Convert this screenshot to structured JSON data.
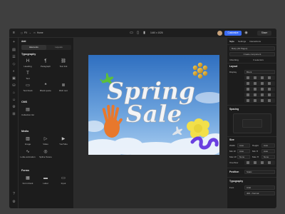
{
  "toolbar": {
    "page_size": "PX",
    "page_name": "Home",
    "canvas_size": "1440 x 1026",
    "publish_label": "Customize",
    "share_label": "Share"
  },
  "add_panel": {
    "title": "Add",
    "tabs": [
      "Elements",
      "Layouts"
    ],
    "sections": {
      "typography": {
        "title": "Typography",
        "items": [
          "Heading",
          "Paragraph",
          "Text link",
          "Text",
          "Text block",
          "Block quote",
          "Rich text"
        ]
      },
      "cms": {
        "title": "CMS",
        "items": [
          "Collection list"
        ]
      },
      "media": {
        "title": "Media",
        "items": [
          "Image",
          "Video",
          "YouTube",
          "Lottie animation",
          "Spline Scene"
        ]
      },
      "forms": {
        "title": "Forms",
        "items": [
          "Form block",
          "Label",
          "Input"
        ]
      }
    }
  },
  "artboard": {
    "headline_line1": "Spring",
    "headline_line2": "Sale",
    "colors": {
      "sky_top": "#2f6fc0",
      "sky_bottom": "#a9cdf0"
    }
  },
  "style_panel": {
    "tabs": [
      "Style",
      "Settings",
      "Interactions"
    ],
    "selector_label": "Body (All Pages)",
    "create_component": "Create component",
    "inheriting": "Inheriting",
    "selectors_count": "3 selectors",
    "layout_title": "Layout",
    "display_label": "Display",
    "display_value": "Block",
    "spacing_title": "Spacing",
    "size_title": "Size",
    "width_label": "Width",
    "height_label": "Height",
    "min_w_label": "Min W",
    "min_h_label": "Min H",
    "max_w_label": "Max W",
    "max_h_label": "Max H",
    "overflow_label": "Overflow",
    "auto": "Auto",
    "none": "None",
    "position_title": "Position",
    "position_value": "Static",
    "typography_title": "Typography",
    "font_label": "Font",
    "font_value": "Arial",
    "weight_value": "400 - Normal"
  },
  "accent": "#3b6cf6"
}
